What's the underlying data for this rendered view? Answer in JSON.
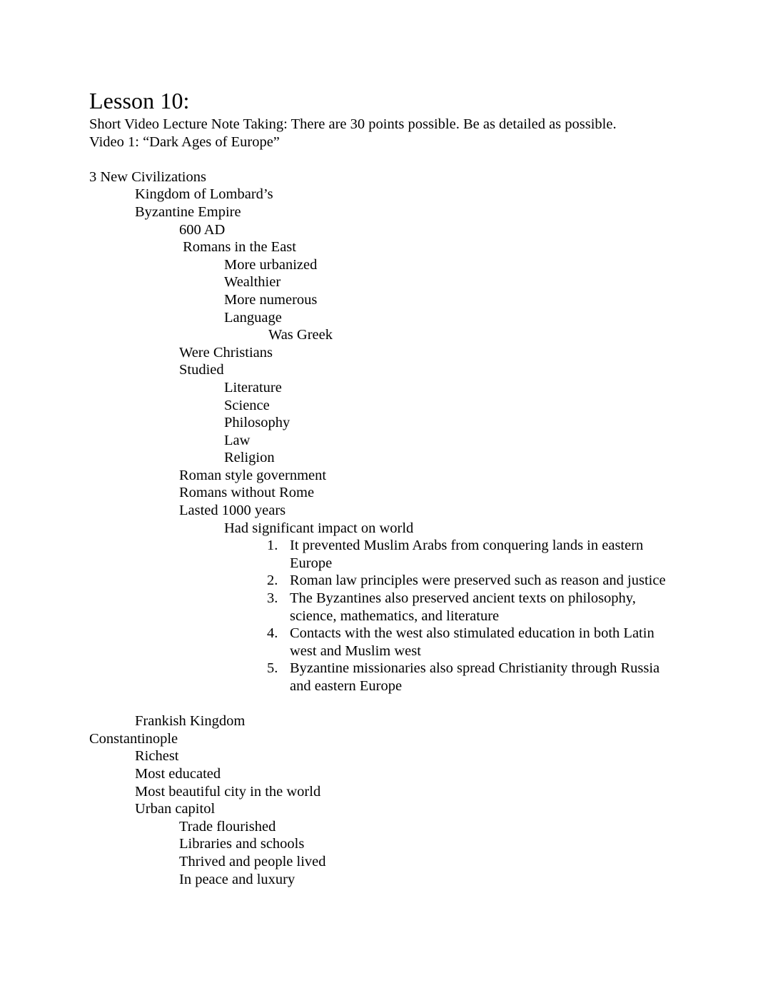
{
  "document": {
    "title": "Lesson 10:",
    "intro": [
      "Short Video Lecture Note Taking: There are 30 points possible. Be as detailed as possible.",
      "Video 1: “Dark Ages of Europe”"
    ],
    "outline": {
      "heading": "3 New Civilizations",
      "kingdom_lombards": "Kingdom of Lombard’s",
      "byzantine_empire": "Byzantine Empire",
      "year_600ad": "600 AD",
      "romans_in_the_east": " Romans in the East",
      "more_urbanized": "More urbanized",
      "wealthier": "Wealthier",
      "more_numerous": "More numerous",
      "language": "Language",
      "was_greek": "Was Greek",
      "were_christians": "Were Christians",
      "studied": "Studied",
      "studied_items": {
        "literature": "Literature",
        "science": "Science",
        "philosophy": "Philosophy",
        "law": "Law",
        "religion": "Religion"
      },
      "roman_style_government": "Roman style government",
      "romans_without_rome": "Romans without Rome",
      "lasted_1000_years": "Lasted 1000 years",
      "had_significant_impact": "Had significant impact on world",
      "impacts": [
        {
          "number": "1.",
          "text": "It prevented Muslim Arabs from conquering lands in eastern Europe"
        },
        {
          "number": "2.",
          "text": "Roman law principles were preserved such as reason and justice"
        },
        {
          "number": "3.",
          "text": "The Byzantines also preserved ancient texts on philosophy, science, mathematics, and literature"
        },
        {
          "number": "4.",
          "text": "Contacts with the west also stimulated education in both Latin west and Muslim west"
        },
        {
          "number": "5.",
          "text": "Byzantine missionaries also spread Christianity through Russia and eastern Europe"
        }
      ],
      "frankish_kingdom": "Frankish Kingdom"
    },
    "constantinople": {
      "heading": "Constantinople",
      "richest": "Richest",
      "most_educated": "Most educated",
      "most_beautiful_city": "Most beautiful city in the world",
      "urban_capitol": "Urban capitol",
      "trade_flourished": "Trade flourished",
      "libraries_and_schools": "Libraries and schools",
      "thrived_and_people_lived": "Thrived and people lived",
      "in_peace_and_luxury": "In peace and luxury"
    }
  }
}
